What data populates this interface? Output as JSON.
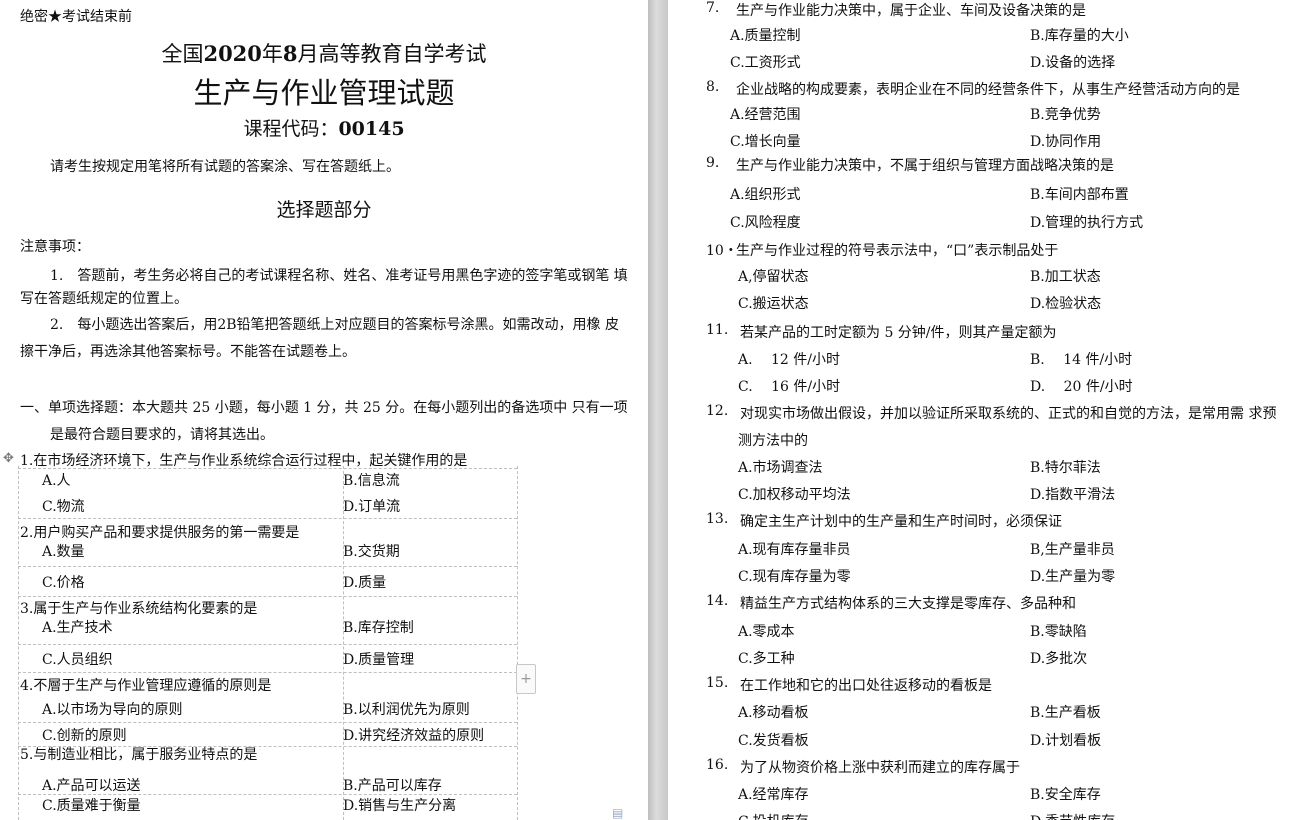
{
  "header": {
    "secret_mark": "绝密★考试结束前",
    "exam_title_part1": "全国",
    "exam_year": "2020",
    "exam_title_part2": "年",
    "exam_month": "8",
    "exam_title_part3": "月高等教育自学考试",
    "paper_title": "生产与作业管理试题",
    "course_code_label": "课程代码：",
    "course_code": "00145",
    "instruction": "请考生按规定用笔将所有试题的答案涂、写在答题纸上。"
  },
  "section_title": "选择题部分",
  "notes": {
    "title": "注意事项：",
    "item1_line1": "1.　答题前，考生务必将自己的考试课程名称、姓名、准考证号用黑色字迹的签字笔或钢笔 填",
    "item1_line2": "写在答题纸规定的位置上。",
    "item2_line1": "2.　每小题选出答案后，用2B铅笔把答题纸上对应题目的答案标号涂黑。如需改动，用橡 皮",
    "item2_line2": "擦干净后，再选涂其他答案标号。不能答在试题卷上。"
  },
  "part_one": {
    "line1": "一、单项选择题：本大题共 25 小题，每小题 1 分，共 25 分。在每小题列出的备选项中 只有一项",
    "line2": "是最符合题目要求的，请将其选出。"
  },
  "left_questions": [
    {
      "stem": "1.在市场经济环境下，生产与作业系统综合运行过程中，起关键作用的是",
      "a": "A.人",
      "b": "B.信息流",
      "c": "C.物流",
      "d": "D.订单流"
    },
    {
      "stem": "2.用户购买产品和要求提供服务的第一需要是",
      "a": "A.数量",
      "b": "B.交货期",
      "c": "C.价格",
      "d": "D.质量"
    },
    {
      "stem": "3.属于生产与作业系统结构化要素的是",
      "a": "A.生产技术",
      "b": "B.库存控制",
      "c": "C.人员组织",
      "d": "D.质量管理"
    },
    {
      "stem": "4.不層于生产与作业管理应遵循的原则是",
      "a": "A.以市场为导向的原则",
      "b": "B.以利润优先为原则",
      "c": "C.创新的原则",
      "d": "D.讲究经济效益的原则"
    },
    {
      "stem": "5.与制造业相比，属于服务业特点的是",
      "a": "A.产品可以运送",
      "b": "B.产品可以库存",
      "c": "C.质量难于衡量",
      "d": "D.销售与生产分离"
    }
  ],
  "right_questions": [
    {
      "num": "7.",
      "stem": "生产与作业能力决策中，属于企业、车间及设备决策的是",
      "a": "A.质量控制",
      "b": "B.库存量的大小",
      "c": "C.工资形式",
      "d": "D.设备的选择"
    },
    {
      "num": "8.",
      "stem": "企业战略的构成要素，表明企业在不同的经营条件下，从事生产经营活动方向的是",
      "a": "A.经营范围",
      "b": "B.竞争优势",
      "c": "C.增长向量",
      "d": "D.协同作用"
    },
    {
      "num": "9.",
      "stem": "生产与作业能力决策中，不属于组织与管理方面战略决策的是",
      "a": "A.组织形式",
      "b": "B.车间内部布置",
      "c": "C.风险程度",
      "d": "D.管理的执行方式"
    },
    {
      "num": "10・",
      "stem": "生产与作业过程的符号表示法中，“口”表示制品处于",
      "a": "A,停留状态",
      "b": "B.加工状态",
      "c": "C.搬运状态",
      "d": "D.检验状态"
    },
    {
      "num": "11.",
      "stem": "若某产品的工时定额为 5 分钟/件，则其产量定额为",
      "a": "A.　 12 件/小时",
      "b": "B.　 14 件/小时",
      "c": "C.　 16 件/小时",
      "d": "D.　 20 件/小时"
    },
    {
      "num": "12.",
      "stem": "对现实市场做出假设，并加以验证所采取系统的、正式的和自觉的方法，是常用需 求预",
      "stem2": "测方法中的",
      "a": "A.市场调查法",
      "b": "B.特尔菲法",
      "c": "C.加权移动平均法",
      "d": "D.指数平滑法"
    },
    {
      "num": "13.",
      "stem": "确定主生产计划中的生产量和生产时间时，必须保证",
      "a": "A.现有库存量非员",
      "b": "B,生产量非员",
      "c": "C.现有库存量为零",
      "d": "D.生产量为零"
    },
    {
      "num": "14.",
      "stem": "精益生产方式结构体系的三大支撑是零库存、多品种和",
      "a": "A.零成本",
      "b": "B.零缺陷",
      "c": "C.多工种",
      "d": "D.多批次"
    },
    {
      "num": "15.",
      "stem": "在工作地和它的出口处往返移动的看板是",
      "a": "A.移动看板",
      "b": "B.生产看板",
      "c": "C.发货看板",
      "d": "D.计划看板"
    },
    {
      "num": "16.",
      "stem": "为了从物资价格上涨中获利而建立的库存属于",
      "a": "A.经常库存",
      "b": "B.安全库存",
      "c": "C.投机库存",
      "d": "D.季节性库存"
    }
  ]
}
